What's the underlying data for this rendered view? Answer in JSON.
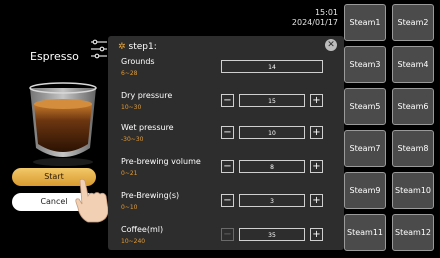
{
  "status": {
    "time": "15:01",
    "date": "2024/01/17"
  },
  "drink": {
    "title": "Espresso"
  },
  "actions": {
    "start_label": "Start",
    "cancel_label": "Cancel"
  },
  "steam_buttons": [
    "Steam1",
    "Steam2",
    "Steam3",
    "Steam4",
    "Steam5",
    "Steam6",
    "Steam7",
    "Steam8",
    "Steam9",
    "Steam10",
    "Steam11",
    "Steam12"
  ],
  "panel": {
    "title": "step1:",
    "close_icon": "close-icon",
    "params": [
      {
        "label": "Grounds",
        "range": "6~28",
        "value": "14",
        "stepper": false
      },
      {
        "label": "Dry pressure",
        "range": "10~30",
        "value": "15",
        "stepper": true
      },
      {
        "label": "Wet pressure",
        "range": "-30~30",
        "value": "10",
        "stepper": true
      },
      {
        "label": "Pre-brewing volume",
        "range": "0~21",
        "value": "8",
        "stepper": true
      },
      {
        "label": "Pre-Brewing(s)",
        "range": "0~10",
        "value": "3",
        "stepper": true
      },
      {
        "label": "Coffee(ml)",
        "range": "10~240",
        "value": "35",
        "stepper": true,
        "minus_disabled": true
      }
    ]
  },
  "colors": {
    "accent": "#e39a34",
    "panel": "#2d2d2d",
    "steam": "#4b4b4b"
  }
}
